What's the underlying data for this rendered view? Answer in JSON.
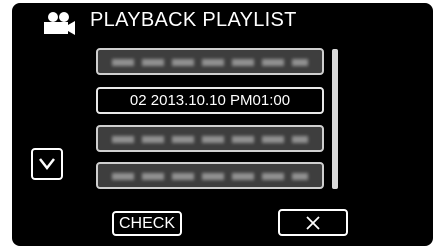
{
  "header": {
    "icon": "video-camera-icon",
    "title": "PLAYBACK PLAYLIST"
  },
  "playlist": {
    "items": [
      {
        "label": "",
        "obscured": true
      },
      {
        "label": "02  2013.10.10  PM01:00",
        "obscured": false,
        "selected": true
      },
      {
        "label": "",
        "obscured": true
      },
      {
        "label": "",
        "obscured": true
      }
    ]
  },
  "controls": {
    "down_icon": "chevron-down-icon",
    "check_label": "CHECK",
    "close_icon": "close-icon"
  },
  "colors": {
    "background": "#000000",
    "text": "#ffffff",
    "item_fill": "#3e3e3e",
    "item_border": "#cfcfcf",
    "scrollbar": "#d9d9d9"
  }
}
